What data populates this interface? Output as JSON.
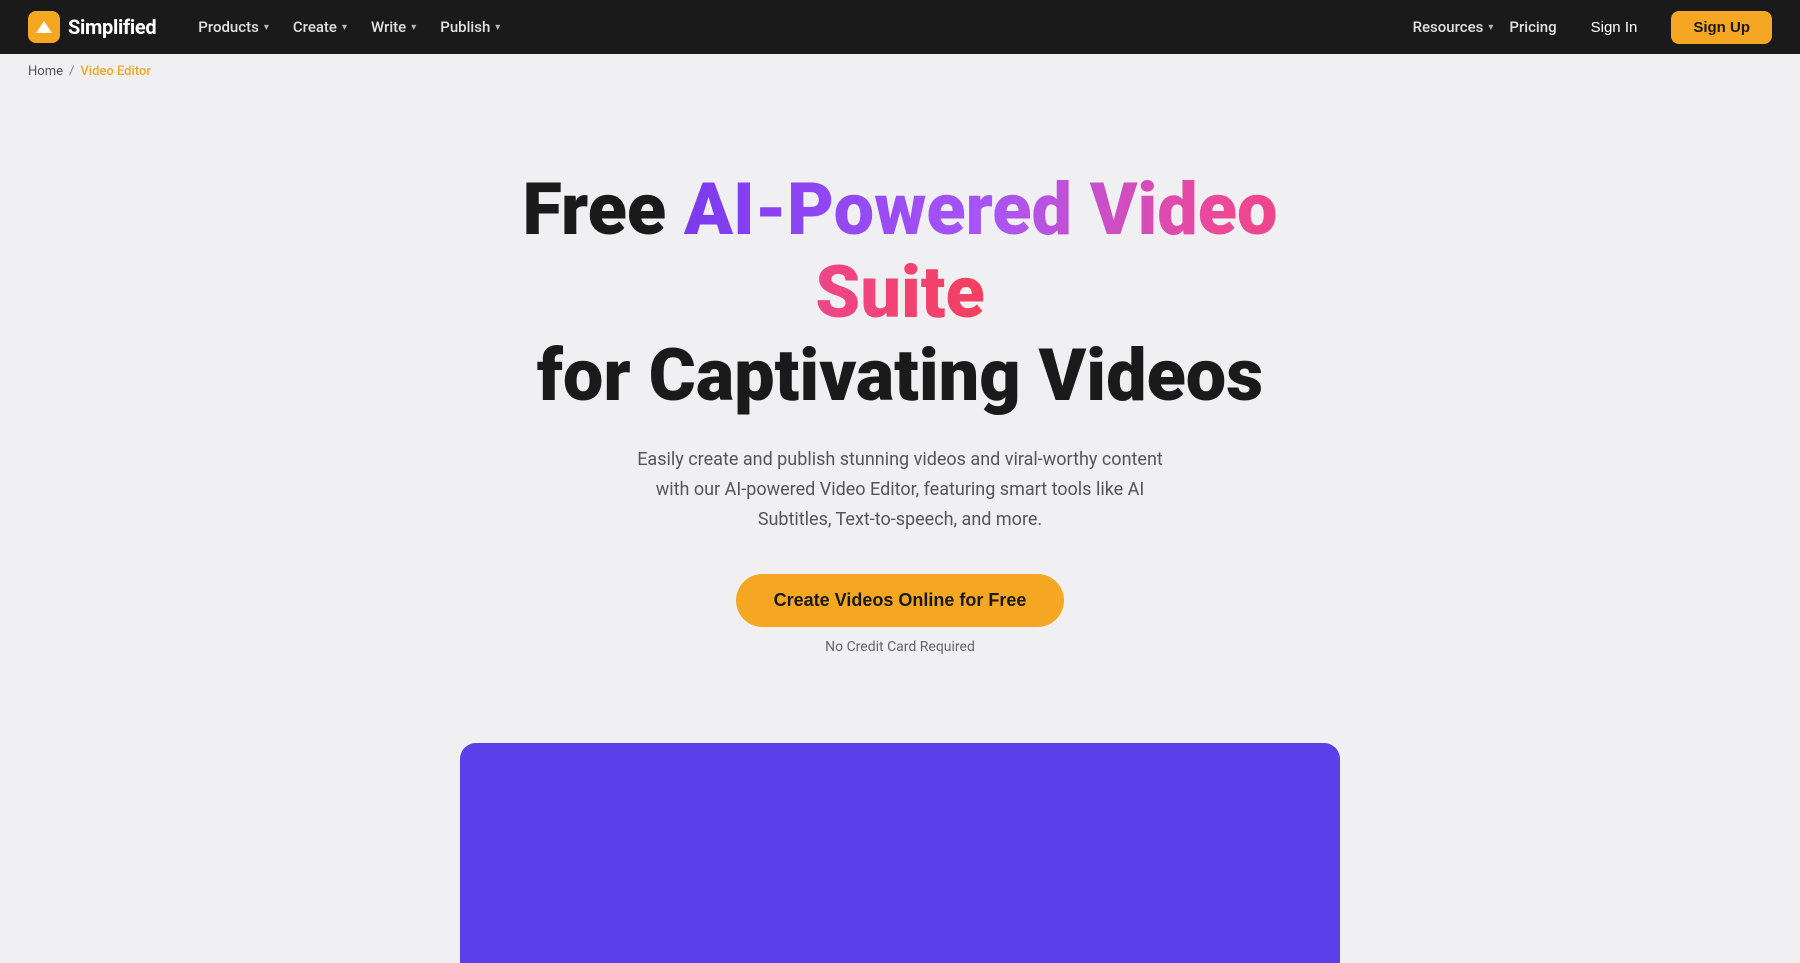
{
  "logo": {
    "text": "Simplified",
    "icon_color": "#f5a623"
  },
  "navbar": {
    "left_items": [
      {
        "label": "Products",
        "has_chevron": true
      },
      {
        "label": "Create",
        "has_chevron": true
      },
      {
        "label": "Write",
        "has_chevron": true
      },
      {
        "label": "Publish",
        "has_chevron": true
      }
    ],
    "right_items": {
      "resources": "Resources",
      "pricing": "Pricing",
      "signin": "Sign In",
      "signup": "Sign Up"
    }
  },
  "breadcrumb": {
    "home": "Home",
    "separator": "/",
    "current": "Video Editor"
  },
  "hero": {
    "title_part1": "Free ",
    "title_gradient": "AI-Powered Video Suite",
    "title_part2": "for Captivating Videos",
    "subtitle": "Easily create and publish stunning videos and viral-worthy content with our AI-powered Video Editor, featuring smart tools like AI Subtitles, Text-to-speech, and more.",
    "cta_label": "Create Videos Online for Free",
    "no_card": "No Credit Card Required"
  }
}
